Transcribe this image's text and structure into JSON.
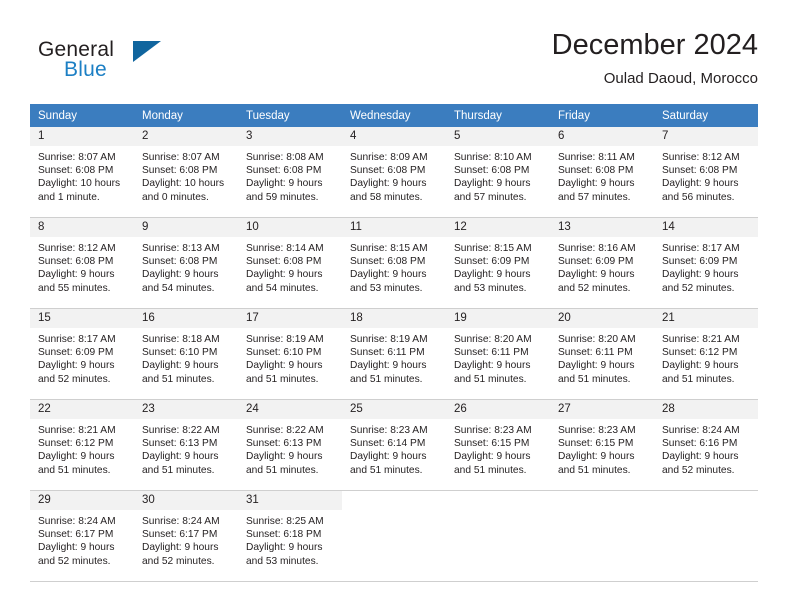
{
  "brand": {
    "name_part1": "General",
    "name_part2": "Blue",
    "logo_icon": "triangle-flag-icon"
  },
  "header": {
    "title": "December 2024",
    "subtitle": "Oulad Daoud, Morocco"
  },
  "colors": {
    "header_row_bg": "#3b7dbf",
    "header_row_text": "#ffffff",
    "daynum_bg": "#f2f2f2",
    "brand_blue": "#1c7fc4",
    "logo_blue": "#10659e",
    "text": "#231f20",
    "grid_line": "#cfcfcf"
  },
  "weekday_headers": [
    "Sunday",
    "Monday",
    "Tuesday",
    "Wednesday",
    "Thursday",
    "Friday",
    "Saturday"
  ],
  "labels": {
    "sunrise_prefix": "Sunrise:",
    "sunset_prefix": "Sunset:",
    "daylight_prefix": "Daylight:"
  },
  "weeks": [
    [
      {
        "day": "1",
        "sunrise": "Sunrise: 8:07 AM",
        "sunset": "Sunset: 6:08 PM",
        "daylight_line1": "Daylight: 10 hours",
        "daylight_line2": "and 1 minute."
      },
      {
        "day": "2",
        "sunrise": "Sunrise: 8:07 AM",
        "sunset": "Sunset: 6:08 PM",
        "daylight_line1": "Daylight: 10 hours",
        "daylight_line2": "and 0 minutes."
      },
      {
        "day": "3",
        "sunrise": "Sunrise: 8:08 AM",
        "sunset": "Sunset: 6:08 PM",
        "daylight_line1": "Daylight: 9 hours",
        "daylight_line2": "and 59 minutes."
      },
      {
        "day": "4",
        "sunrise": "Sunrise: 8:09 AM",
        "sunset": "Sunset: 6:08 PM",
        "daylight_line1": "Daylight: 9 hours",
        "daylight_line2": "and 58 minutes."
      },
      {
        "day": "5",
        "sunrise": "Sunrise: 8:10 AM",
        "sunset": "Sunset: 6:08 PM",
        "daylight_line1": "Daylight: 9 hours",
        "daylight_line2": "and 57 minutes."
      },
      {
        "day": "6",
        "sunrise": "Sunrise: 8:11 AM",
        "sunset": "Sunset: 6:08 PM",
        "daylight_line1": "Daylight: 9 hours",
        "daylight_line2": "and 57 minutes."
      },
      {
        "day": "7",
        "sunrise": "Sunrise: 8:12 AM",
        "sunset": "Sunset: 6:08 PM",
        "daylight_line1": "Daylight: 9 hours",
        "daylight_line2": "and 56 minutes."
      }
    ],
    [
      {
        "day": "8",
        "sunrise": "Sunrise: 8:12 AM",
        "sunset": "Sunset: 6:08 PM",
        "daylight_line1": "Daylight: 9 hours",
        "daylight_line2": "and 55 minutes."
      },
      {
        "day": "9",
        "sunrise": "Sunrise: 8:13 AM",
        "sunset": "Sunset: 6:08 PM",
        "daylight_line1": "Daylight: 9 hours",
        "daylight_line2": "and 54 minutes."
      },
      {
        "day": "10",
        "sunrise": "Sunrise: 8:14 AM",
        "sunset": "Sunset: 6:08 PM",
        "daylight_line1": "Daylight: 9 hours",
        "daylight_line2": "and 54 minutes."
      },
      {
        "day": "11",
        "sunrise": "Sunrise: 8:15 AM",
        "sunset": "Sunset: 6:08 PM",
        "daylight_line1": "Daylight: 9 hours",
        "daylight_line2": "and 53 minutes."
      },
      {
        "day": "12",
        "sunrise": "Sunrise: 8:15 AM",
        "sunset": "Sunset: 6:09 PM",
        "daylight_line1": "Daylight: 9 hours",
        "daylight_line2": "and 53 minutes."
      },
      {
        "day": "13",
        "sunrise": "Sunrise: 8:16 AM",
        "sunset": "Sunset: 6:09 PM",
        "daylight_line1": "Daylight: 9 hours",
        "daylight_line2": "and 52 minutes."
      },
      {
        "day": "14",
        "sunrise": "Sunrise: 8:17 AM",
        "sunset": "Sunset: 6:09 PM",
        "daylight_line1": "Daylight: 9 hours",
        "daylight_line2": "and 52 minutes."
      }
    ],
    [
      {
        "day": "15",
        "sunrise": "Sunrise: 8:17 AM",
        "sunset": "Sunset: 6:09 PM",
        "daylight_line1": "Daylight: 9 hours",
        "daylight_line2": "and 52 minutes."
      },
      {
        "day": "16",
        "sunrise": "Sunrise: 8:18 AM",
        "sunset": "Sunset: 6:10 PM",
        "daylight_line1": "Daylight: 9 hours",
        "daylight_line2": "and 51 minutes."
      },
      {
        "day": "17",
        "sunrise": "Sunrise: 8:19 AM",
        "sunset": "Sunset: 6:10 PM",
        "daylight_line1": "Daylight: 9 hours",
        "daylight_line2": "and 51 minutes."
      },
      {
        "day": "18",
        "sunrise": "Sunrise: 8:19 AM",
        "sunset": "Sunset: 6:11 PM",
        "daylight_line1": "Daylight: 9 hours",
        "daylight_line2": "and 51 minutes."
      },
      {
        "day": "19",
        "sunrise": "Sunrise: 8:20 AM",
        "sunset": "Sunset: 6:11 PM",
        "daylight_line1": "Daylight: 9 hours",
        "daylight_line2": "and 51 minutes."
      },
      {
        "day": "20",
        "sunrise": "Sunrise: 8:20 AM",
        "sunset": "Sunset: 6:11 PM",
        "daylight_line1": "Daylight: 9 hours",
        "daylight_line2": "and 51 minutes."
      },
      {
        "day": "21",
        "sunrise": "Sunrise: 8:21 AM",
        "sunset": "Sunset: 6:12 PM",
        "daylight_line1": "Daylight: 9 hours",
        "daylight_line2": "and 51 minutes."
      }
    ],
    [
      {
        "day": "22",
        "sunrise": "Sunrise: 8:21 AM",
        "sunset": "Sunset: 6:12 PM",
        "daylight_line1": "Daylight: 9 hours",
        "daylight_line2": "and 51 minutes."
      },
      {
        "day": "23",
        "sunrise": "Sunrise: 8:22 AM",
        "sunset": "Sunset: 6:13 PM",
        "daylight_line1": "Daylight: 9 hours",
        "daylight_line2": "and 51 minutes."
      },
      {
        "day": "24",
        "sunrise": "Sunrise: 8:22 AM",
        "sunset": "Sunset: 6:13 PM",
        "daylight_line1": "Daylight: 9 hours",
        "daylight_line2": "and 51 minutes."
      },
      {
        "day": "25",
        "sunrise": "Sunrise: 8:23 AM",
        "sunset": "Sunset: 6:14 PM",
        "daylight_line1": "Daylight: 9 hours",
        "daylight_line2": "and 51 minutes."
      },
      {
        "day": "26",
        "sunrise": "Sunrise: 8:23 AM",
        "sunset": "Sunset: 6:15 PM",
        "daylight_line1": "Daylight: 9 hours",
        "daylight_line2": "and 51 minutes."
      },
      {
        "day": "27",
        "sunrise": "Sunrise: 8:23 AM",
        "sunset": "Sunset: 6:15 PM",
        "daylight_line1": "Daylight: 9 hours",
        "daylight_line2": "and 51 minutes."
      },
      {
        "day": "28",
        "sunrise": "Sunrise: 8:24 AM",
        "sunset": "Sunset: 6:16 PM",
        "daylight_line1": "Daylight: 9 hours",
        "daylight_line2": "and 52 minutes."
      }
    ],
    [
      {
        "day": "29",
        "sunrise": "Sunrise: 8:24 AM",
        "sunset": "Sunset: 6:17 PM",
        "daylight_line1": "Daylight: 9 hours",
        "daylight_line2": "and 52 minutes."
      },
      {
        "day": "30",
        "sunrise": "Sunrise: 8:24 AM",
        "sunset": "Sunset: 6:17 PM",
        "daylight_line1": "Daylight: 9 hours",
        "daylight_line2": "and 52 minutes."
      },
      {
        "day": "31",
        "sunrise": "Sunrise: 8:25 AM",
        "sunset": "Sunset: 6:18 PM",
        "daylight_line1": "Daylight: 9 hours",
        "daylight_line2": "and 53 minutes."
      },
      {
        "day": "",
        "sunrise": "",
        "sunset": "",
        "daylight_line1": "",
        "daylight_line2": ""
      },
      {
        "day": "",
        "sunrise": "",
        "sunset": "",
        "daylight_line1": "",
        "daylight_line2": ""
      },
      {
        "day": "",
        "sunrise": "",
        "sunset": "",
        "daylight_line1": "",
        "daylight_line2": ""
      },
      {
        "day": "",
        "sunrise": "",
        "sunset": "",
        "daylight_line1": "",
        "daylight_line2": ""
      }
    ]
  ]
}
